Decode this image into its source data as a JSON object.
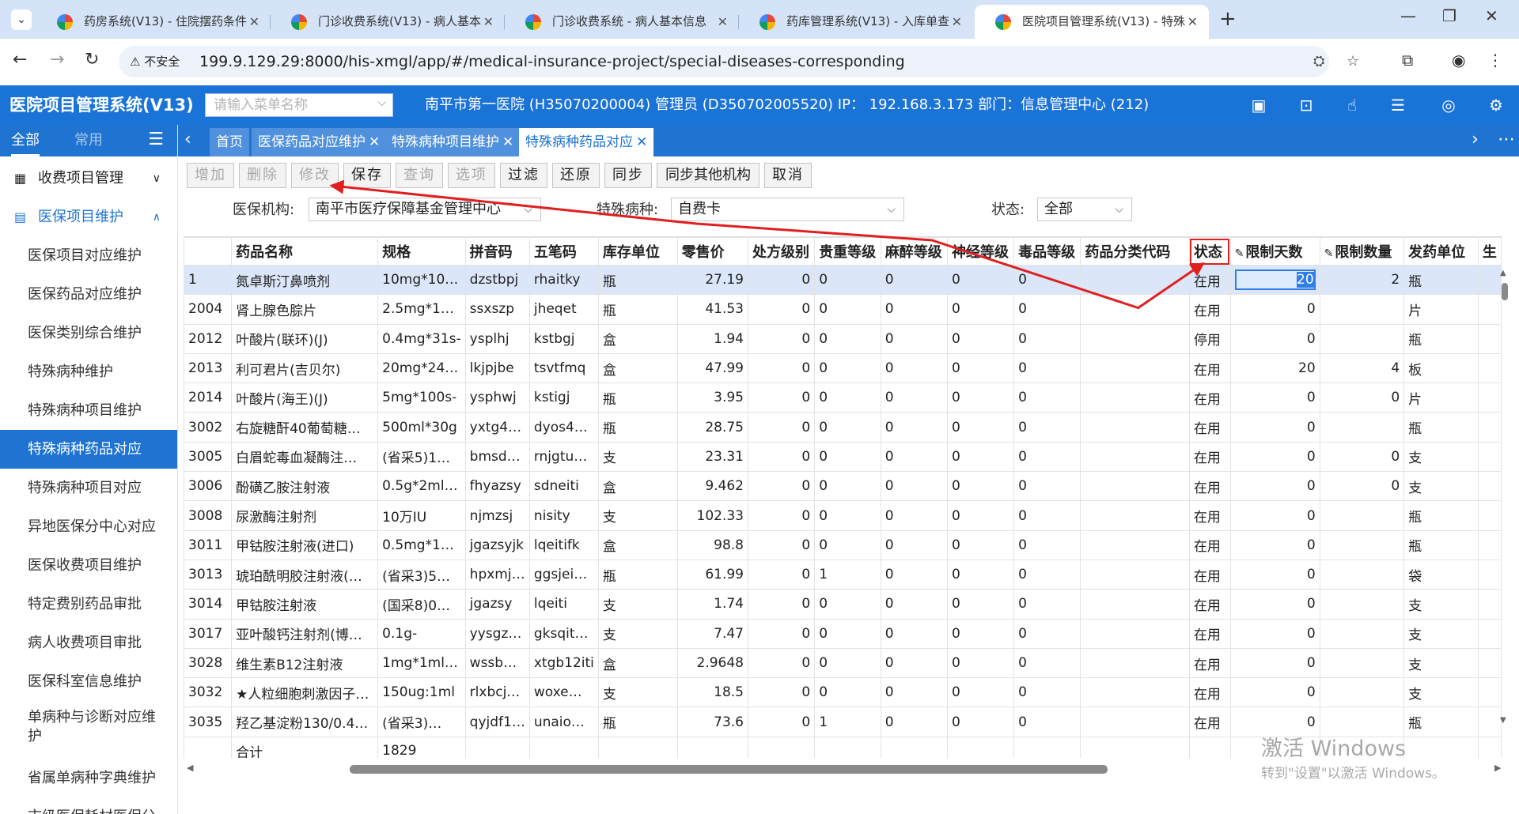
{
  "browser": {
    "tabs": [
      {
        "title": "药房系统(V13) - 住院摆药条件"
      },
      {
        "title": "门诊收费系统(V13) - 病人基本"
      },
      {
        "title": "门诊收费系统 - 病人基本信息"
      },
      {
        "title": "药库管理系统(V13) - 入库单查"
      },
      {
        "title": "医院项目管理系统(V13) - 特殊"
      }
    ],
    "new_tab": "+",
    "insecure_label": "不安全",
    "url": "199.9.129.29:8000/his-xmgl/app/#/medical-insurance-project/special-diseases-corresponding"
  },
  "header": {
    "app_title": "医院项目管理系统(V13)",
    "search_placeholder": "请输入菜单名称",
    "info": "南平市第一医院 (H35070200004) 管理员 (D350702005520) IP： 192.168.3.173 部门：信息管理中心 (212)"
  },
  "sidebar": {
    "tabs": [
      "全部",
      "常用"
    ],
    "groups": [
      {
        "label": "收费项目管理"
      },
      {
        "label": "医保项目维护"
      }
    ],
    "items": [
      {
        "label": "医保项目对应维护"
      },
      {
        "label": "医保药品对应维护"
      },
      {
        "label": "医保类别综合维护"
      },
      {
        "label": "特殊病种维护"
      },
      {
        "label": "特殊病种项目维护"
      },
      {
        "label": "特殊病种药品对应"
      },
      {
        "label": "特殊病种项目对应"
      },
      {
        "label": "异地医保分中心对应"
      },
      {
        "label": "医保收费项目维护"
      },
      {
        "label": "特定费别药品审批"
      },
      {
        "label": "病人收费项目审批"
      },
      {
        "label": "医保科室信息维护"
      },
      {
        "label": "单病种与诊断对应维护"
      },
      {
        "label": "省属单病种字典维护"
      },
      {
        "label": "市级医保耗材医保分"
      }
    ]
  },
  "page_tabs": [
    {
      "label": "首页"
    },
    {
      "label": "医保药品对应维护"
    },
    {
      "label": "特殊病种项目维护"
    },
    {
      "label": "特殊病种药品对应"
    }
  ],
  "toolbar": {
    "add": "增加",
    "delete": "删除",
    "modify": "修改",
    "save": "保存",
    "query": "查询",
    "options": "选项",
    "filter": "过滤",
    "restore": "还原",
    "sync": "同步",
    "sync_other": "同步其他机构",
    "cancel": "取消"
  },
  "filters": {
    "org_label": "医保机构:",
    "org_value": "南平市医疗保障基金管理中心",
    "disease_label": "特殊病种:",
    "disease_value": "自费卡",
    "status_label": "状态:",
    "status_value": "全部"
  },
  "grid": {
    "columns": [
      "",
      "药品名称",
      "规格",
      "拼音码",
      "五笔码",
      "库存单位",
      "零售价",
      "处方级别",
      "贵重等级",
      "麻醉等级",
      "神经等级",
      "毒品等级",
      "药品分类代码",
      "状态",
      "限制天数",
      "限制数量",
      "发药单位",
      "生"
    ],
    "selected_days_value": "20",
    "rows": [
      [
        "1",
        "氮卓斯汀鼻喷剂",
        "10mg*10…",
        "dzstbpj",
        "rhaitky",
        "瓶",
        "27.19",
        "0",
        "0",
        "0",
        "0",
        "0",
        "",
        "在用",
        "",
        "2",
        "瓶"
      ],
      [
        "2004",
        "肾上腺色腙片",
        "2.5mg*1…",
        "ssxszp",
        "jheqet",
        "瓶",
        "41.53",
        "0",
        "0",
        "0",
        "0",
        "0",
        "",
        "在用",
        "0",
        "",
        "片"
      ],
      [
        "2012",
        "叶酸片(联环)(J)",
        "0.4mg*31s-",
        "ysplhj",
        "kstbgj",
        "盒",
        "1.94",
        "0",
        "0",
        "0",
        "0",
        "0",
        "",
        "停用",
        "0",
        "",
        "瓶"
      ],
      [
        "2013",
        "利可君片(吉贝尔)",
        "20mg*24…",
        "lkjpjbe",
        "tsvtfmq",
        "盒",
        "47.99",
        "0",
        "0",
        "0",
        "0",
        "0",
        "",
        "在用",
        "20",
        "4",
        "板"
      ],
      [
        "2014",
        "叶酸片(海王)(J)",
        "5mg*100s-",
        "ysphwj",
        "kstigj",
        "瓶",
        "3.95",
        "0",
        "0",
        "0",
        "0",
        "0",
        "",
        "在用",
        "0",
        "0",
        "片"
      ],
      [
        "3002",
        "右旋糖酐40葡萄糖…",
        "500ml*30g",
        "yxtg4…",
        "dyos4…",
        "瓶",
        "28.75",
        "0",
        "0",
        "0",
        "0",
        "0",
        "",
        "在用",
        "0",
        "",
        "瓶"
      ],
      [
        "3005",
        "白眉蛇毒血凝酶注…",
        "(省采5)1…",
        "bmsd…",
        "rnjgtu…",
        "支",
        "23.31",
        "0",
        "0",
        "0",
        "0",
        "0",
        "",
        "在用",
        "0",
        "0",
        "支"
      ],
      [
        "3006",
        "酚磺乙胺注射液",
        "0.5g*2ml…",
        "fhyazsy",
        "sdneiti",
        "盒",
        "9.462",
        "0",
        "0",
        "0",
        "0",
        "0",
        "",
        "在用",
        "0",
        "0",
        "支"
      ],
      [
        "3008",
        "尿激酶注射剂",
        "10万IU",
        "njmzsj",
        "nisity",
        "支",
        "102.33",
        "0",
        "0",
        "0",
        "0",
        "0",
        "",
        "在用",
        "0",
        "",
        "瓶"
      ],
      [
        "3011",
        "甲钴胺注射液(进口)",
        "0.5mg*1…",
        "jgazsyjk",
        "lqeitifk",
        "盒",
        "98.8",
        "0",
        "0",
        "0",
        "0",
        "0",
        "",
        "在用",
        "0",
        "",
        "瓶"
      ],
      [
        "3013",
        "琥珀酰明胶注射液(…",
        "(省采3)5…",
        "hpxmj…",
        "ggsjei…",
        "瓶",
        "61.99",
        "0",
        "1",
        "0",
        "0",
        "0",
        "",
        "在用",
        "0",
        "",
        "袋"
      ],
      [
        "3014",
        "甲钴胺注射液",
        "(国采8)0…",
        "jgazsy",
        "lqeiti",
        "支",
        "1.74",
        "0",
        "0",
        "0",
        "0",
        "0",
        "",
        "在用",
        "0",
        "",
        "支"
      ],
      [
        "3017",
        "亚叶酸钙注射剂(博…",
        "0.1g-",
        "yysgz…",
        "gksqit…",
        "支",
        "7.47",
        "0",
        "0",
        "0",
        "0",
        "0",
        "",
        "在用",
        "0",
        "",
        "支"
      ],
      [
        "3028",
        "维生素B12注射液",
        "1mg*1ml…",
        "wssb…",
        "xtgb12iti",
        "盒",
        "2.9648",
        "0",
        "0",
        "0",
        "0",
        "0",
        "",
        "在用",
        "0",
        "",
        "支"
      ],
      [
        "3032",
        "★人粒细胞刺激因子…",
        "150ug:1ml",
        "rlxbcj…",
        "woxe…",
        "支",
        "18.5",
        "0",
        "0",
        "0",
        "0",
        "0",
        "",
        "在用",
        "0",
        "",
        "支"
      ],
      [
        "3035",
        "羟乙基淀粉130/0.4…",
        "(省采3)…",
        "qyjdf1…",
        "unaio…",
        "瓶",
        "73.6",
        "0",
        "1",
        "0",
        "0",
        "0",
        "",
        "在用",
        "0",
        "",
        "瓶"
      ]
    ],
    "total_label": "合计",
    "total_value": "1829"
  },
  "watermark": {
    "line1": "激活 Windows",
    "line2": "转到\"设置\"以激活 Windows。"
  }
}
